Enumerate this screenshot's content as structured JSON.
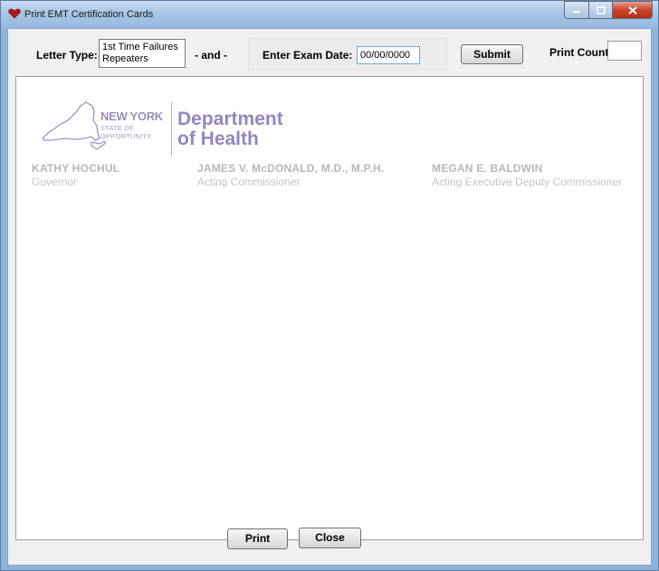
{
  "window": {
    "title": "Print EMT Certification Cards",
    "controls": [
      "minimize",
      "maximize",
      "close"
    ]
  },
  "toolbar": {
    "letter_type_label": "Letter Type:",
    "letter_type_options": [
      "1st Time Failures",
      "Repeaters"
    ],
    "and_label": "- and -",
    "exam_date_label": "Enter Exam Date:",
    "exam_date_value": "00/00/0000",
    "submit_label": "Submit",
    "print_count_label": "Print Count:",
    "print_count_value": ""
  },
  "letterhead": {
    "ny_line1": "NEW YORK",
    "ny_line2": "STATE OF",
    "ny_line3": "OPPORTUNITY.",
    "dept_line1": "Department",
    "dept_line2": "of Health",
    "officials": [
      {
        "name": "KATHY HOCHUL",
        "title": "Governor"
      },
      {
        "name": "JAMES V. McDONALD, M.D., M.P.H.",
        "title": "Acting Commissioner"
      },
      {
        "name": "MEGAN E. BALDWIN",
        "title": "Acting Executive Deputy Commissioner"
      }
    ]
  },
  "footer": {
    "print_label": "Print",
    "close_label": "Close"
  },
  "colors": {
    "title_bar": "#a8c5e6",
    "letterhead_purple": "#9585bf",
    "official_gray": "#b8b8b8"
  }
}
